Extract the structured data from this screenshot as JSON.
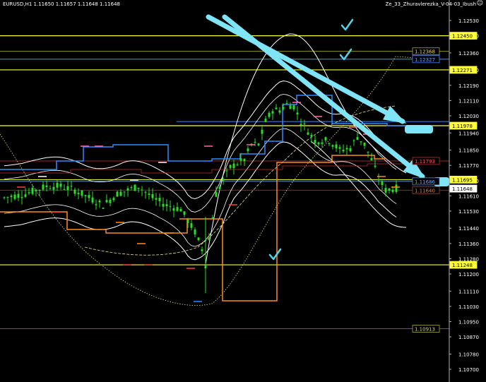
{
  "window": {
    "symbol_info": "EURUSD,H1  1.11650 1.11657 1.11648 1.11648",
    "indicator_name": "Ze_33_Zhuravlerezka_V-04-03_Ibush",
    "smiley_icon": "smiley-icon"
  },
  "colors": {
    "background": "#000000",
    "candle": "#27e023",
    "yellow_level": "#ffff33",
    "orange": "#ff8c1a",
    "blue": "#2f8cff",
    "cyan_arrow": "#7fe4f5",
    "red": "#ff4040",
    "pink": "#ff6aa8",
    "white": "#ffffff"
  },
  "price_scale": {
    "ticks": [
      "1.12530",
      "1.12450",
      "1.12360",
      "1.12270",
      "1.12190",
      "1.12110",
      "1.12030",
      "1.11940",
      "1.11850",
      "1.11770",
      "1.11690",
      "1.11610",
      "1.11530",
      "1.11440",
      "1.11360",
      "1.11280",
      "1.11200",
      "1.11110",
      "1.11030",
      "1.10950",
      "1.10870",
      "1.10780",
      "1.10700"
    ],
    "labels": [
      {
        "text": "1.12450",
        "style": "yellow"
      },
      {
        "text": "1.12368",
        "style": "dark-yellow"
      },
      {
        "text": "1.12327",
        "style": "blue"
      },
      {
        "text": "1.12271",
        "style": "yellow"
      },
      {
        "text": "1.11978",
        "style": "yellow"
      },
      {
        "text": "1.11793",
        "style": "red"
      },
      {
        "text": "1.11695",
        "style": "yellow"
      },
      {
        "text": "1.11686",
        "style": "blue"
      },
      {
        "text": "1.11648",
        "style": "white"
      },
      {
        "text": "1.11640",
        "style": "brown"
      },
      {
        "text": "1.11248",
        "style": "yellow"
      },
      {
        "text": "1.10913",
        "style": "dark-yellow"
      }
    ]
  },
  "annotations": {
    "checkmarks": 3,
    "arrows": 2
  }
}
